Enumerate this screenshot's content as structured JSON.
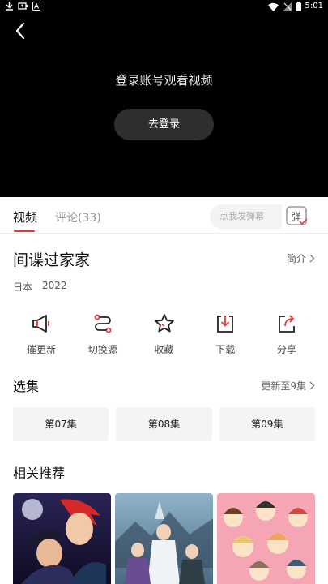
{
  "status_bar": {
    "time": "5:01",
    "left_icons": [
      "download-icon",
      "battery-saver-icon",
      "a-icon"
    ],
    "right_icons": [
      "wifi-icon",
      "no-signal-icon",
      "battery-icon"
    ]
  },
  "player": {
    "prompt": "登录账号观看视频",
    "login_button": "去登录"
  },
  "tabs": {
    "video": "视频",
    "comments": "评论(33)",
    "danmu_placeholder": "点我发弹幕",
    "danmu_toggle": "弹"
  },
  "show": {
    "title": "间谍过家家",
    "intro": "简介",
    "region": "日本",
    "year": "2022"
  },
  "actions": [
    {
      "label": "催更新",
      "icon": "megaphone-icon"
    },
    {
      "label": "切换源",
      "icon": "route-switch-icon"
    },
    {
      "label": "收藏",
      "icon": "star-icon"
    },
    {
      "label": "下载",
      "icon": "download-box-icon"
    },
    {
      "label": "分享",
      "icon": "share-icon"
    }
  ],
  "episodes": {
    "title": "选集",
    "update_status": "更新至9集",
    "items": [
      "第07集",
      "第08集",
      "第09集"
    ]
  },
  "recommendations": {
    "title": "相关推荐"
  },
  "colors": {
    "accent": "#e53935",
    "player_bg": "#000000",
    "button_bg": "#2e2e2e"
  }
}
